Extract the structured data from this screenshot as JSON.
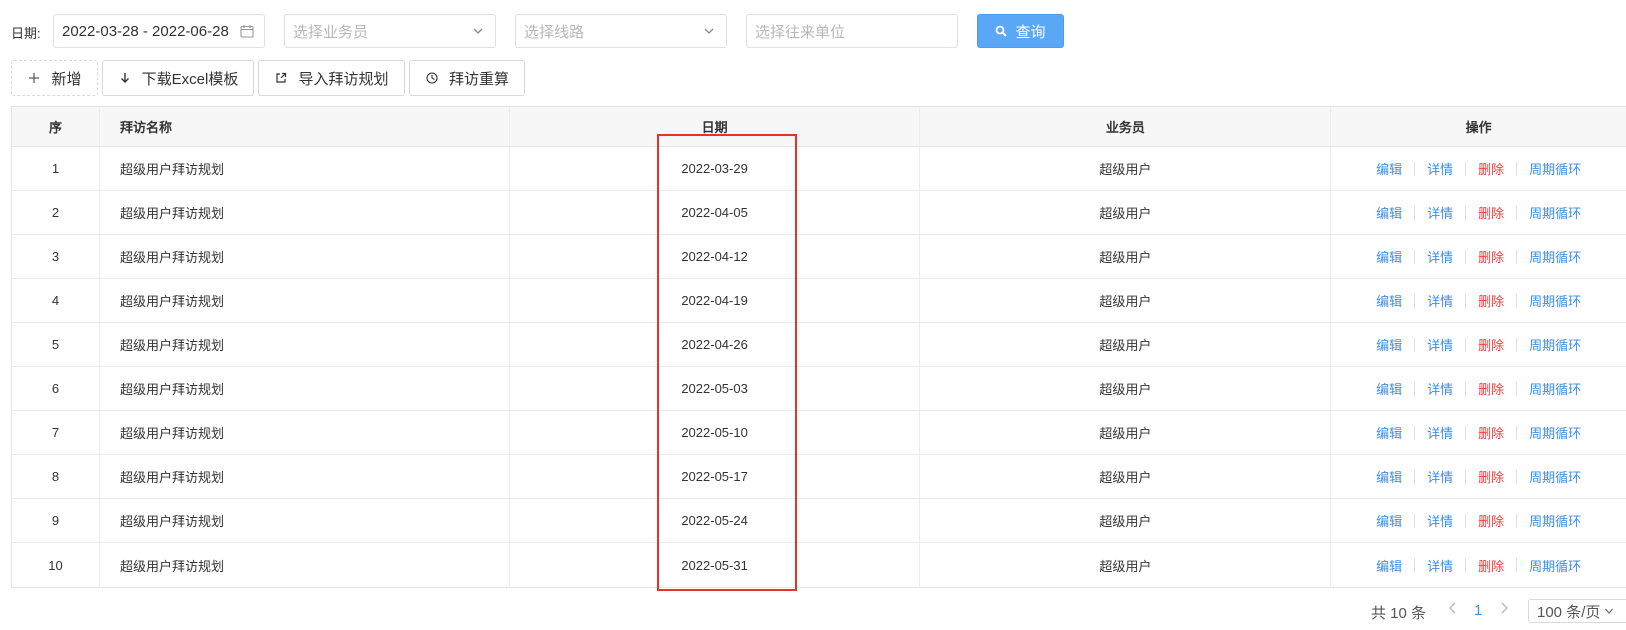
{
  "filters": {
    "date_label": "日期:",
    "date_range": "2022-03-28 - 2022-06-28",
    "salesman_placeholder": "选择业务员",
    "route_placeholder": "选择线路",
    "partner_placeholder": "选择往来单位",
    "query_label": "查询"
  },
  "toolbar": {
    "add_label": "新增",
    "download_label": "下载Excel模板",
    "import_label": "导入拜访规划",
    "recalc_label": "拜访重算"
  },
  "table": {
    "columns": [
      "序",
      "拜访名称",
      "日期",
      "业务员",
      "操作"
    ],
    "rows": [
      {
        "idx": "1",
        "name": "超级用户拜访规划",
        "date": "2022-03-29",
        "user": "超级用户"
      },
      {
        "idx": "2",
        "name": "超级用户拜访规划",
        "date": "2022-04-05",
        "user": "超级用户"
      },
      {
        "idx": "3",
        "name": "超级用户拜访规划",
        "date": "2022-04-12",
        "user": "超级用户"
      },
      {
        "idx": "4",
        "name": "超级用户拜访规划",
        "date": "2022-04-19",
        "user": "超级用户"
      },
      {
        "idx": "5",
        "name": "超级用户拜访规划",
        "date": "2022-04-26",
        "user": "超级用户"
      },
      {
        "idx": "6",
        "name": "超级用户拜访规划",
        "date": "2022-05-03",
        "user": "超级用户"
      },
      {
        "idx": "7",
        "name": "超级用户拜访规划",
        "date": "2022-05-10",
        "user": "超级用户"
      },
      {
        "idx": "8",
        "name": "超级用户拜访规划",
        "date": "2022-05-17",
        "user": "超级用户"
      },
      {
        "idx": "9",
        "name": "超级用户拜访规划",
        "date": "2022-05-24",
        "user": "超级用户"
      },
      {
        "idx": "10",
        "name": "超级用户拜访规划",
        "date": "2022-05-31",
        "user": "超级用户"
      }
    ],
    "actions": {
      "edit": "编辑",
      "detail": "详情",
      "delete": "删除",
      "cycle": "周期循环"
    }
  },
  "pagination": {
    "total": "共 10 条",
    "current_page": "1",
    "page_size": "100 条/页"
  },
  "colors": {
    "primary": "#5aa8f5",
    "link": "#3d8ee8",
    "danger": "#f23c3c",
    "highlight_box": "#e5322d"
  },
  "icons": [
    "calendar-icon",
    "chevron-down-icon",
    "search-icon",
    "plus-icon",
    "download-arrow-icon",
    "external-link-icon",
    "clock-icon",
    "chevron-left-icon",
    "chevron-right-icon"
  ]
}
